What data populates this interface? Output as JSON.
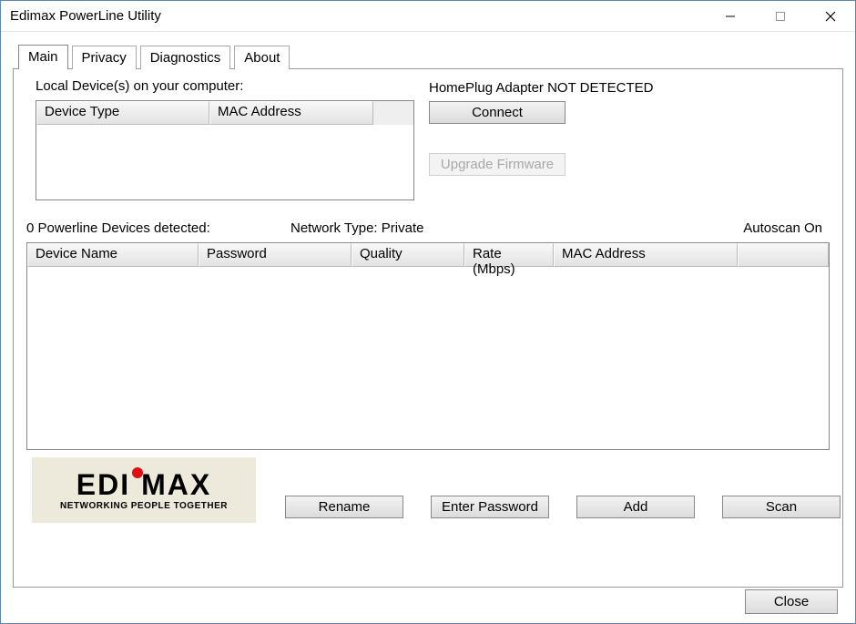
{
  "window": {
    "title": "Edimax PowerLine Utility"
  },
  "tabs": {
    "main": "Main",
    "privacy": "Privacy",
    "diagnostics": "Diagnostics",
    "about": "About"
  },
  "local": {
    "label": "Local Device(s) on your computer:",
    "col_device_type": "Device Type",
    "col_mac": "MAC Address"
  },
  "status": {
    "text": "HomePlug Adapter NOT DETECTED",
    "connect": "Connect",
    "upgrade": "Upgrade Firmware"
  },
  "info": {
    "detected": "0 Powerline Devices detected:",
    "network_type": "Network Type: Private",
    "autoscan": "Autoscan On"
  },
  "pl_list": {
    "device_name": "Device Name",
    "password": "Password",
    "quality": "Quality",
    "rate": "Rate (Mbps)",
    "mac": "MAC Address"
  },
  "logo": {
    "tagline": "NETWORKING PEOPLE TOGETHER"
  },
  "actions": {
    "rename": "Rename",
    "enter_password": "Enter Password",
    "add": "Add",
    "scan": "Scan"
  },
  "footer": {
    "close": "Close"
  }
}
